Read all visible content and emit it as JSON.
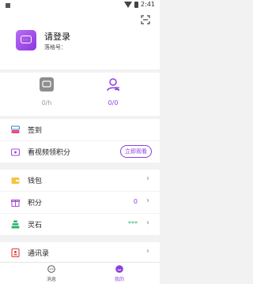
{
  "status_bar": {
    "time": "2:41"
  },
  "header": {
    "login_title": "请登录",
    "account_label": "落格号："
  },
  "stats": [
    {
      "value": "0/h"
    },
    {
      "value": "0/0"
    }
  ],
  "menu": {
    "checkin": "签到",
    "watch_video": "看视频领积分",
    "watch_button": "立即观看",
    "wallet": "钱包",
    "points": "积分",
    "points_value": "0",
    "spirit_stone": "灵石",
    "spirit_value": "***",
    "contacts": "通讯录"
  },
  "bottom_nav": [
    {
      "label": "消息"
    },
    {
      "label": "我的"
    }
  ],
  "colors": {
    "accent": "#8b3fe0",
    "green": "#2ab36a"
  }
}
